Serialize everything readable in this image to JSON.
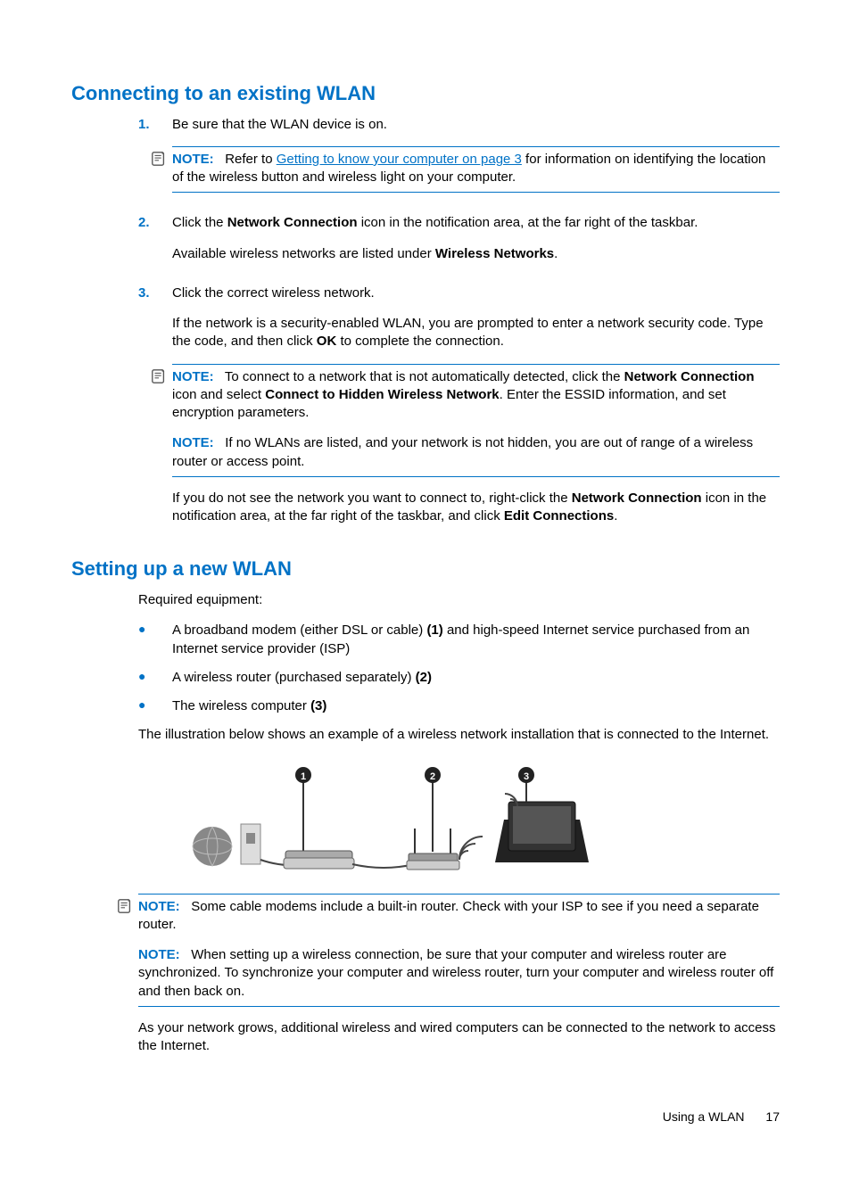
{
  "section1": {
    "title": "Connecting to an existing WLAN"
  },
  "step1": {
    "num": "1.",
    "text": "Be sure that the WLAN device is on."
  },
  "note1": {
    "label": "NOTE:",
    "pre": "Refer to ",
    "link": "Getting to know your computer on page 3",
    "post": " for information on identifying the location of the wireless button and wireless light on your computer."
  },
  "step2": {
    "num": "2.",
    "p1a": "Click the ",
    "p1b": "Network Connection",
    "p1c": " icon in the notification area, at the far right of the taskbar.",
    "p2a": "Available wireless networks are listed under ",
    "p2b": "Wireless Networks",
    "p2c": "."
  },
  "step3": {
    "num": "3.",
    "p1": "Click the correct wireless network.",
    "p2a": "If the network is a security-enabled WLAN, you are prompted to enter a network security code. Type the code, and then click ",
    "p2b": "OK",
    "p2c": " to complete the connection."
  },
  "note2": {
    "label": "NOTE:",
    "t1": "To connect to a network that is not automatically detected, click the ",
    "b1": "Network Connection",
    "t2": " icon and select ",
    "b2": "Connect to Hidden Wireless Network",
    "t3": ". Enter the ESSID information, and set encryption parameters.",
    "second_label": "NOTE:",
    "s1": "If no WLANs are listed, and your network is not hidden, you are out of range of a wireless router or access point."
  },
  "post3": {
    "a": "If you do not see the network you want to connect to, right-click the ",
    "b": "Network Connection",
    "c": " icon in the notification area, at the far right of the taskbar, and click ",
    "d": "Edit Connections",
    "e": "."
  },
  "section2": {
    "title": "Setting up a new WLAN"
  },
  "req_intro": "Required equipment:",
  "bul1": {
    "a": "A broadband modem (either DSL or cable) ",
    "b": "(1)",
    "c": " and high-speed Internet service purchased from an Internet service provider (ISP)"
  },
  "bul2": {
    "a": "A wireless router (purchased separately) ",
    "b": "(2)"
  },
  "bul3": {
    "a": "The wireless computer ",
    "b": "(3)"
  },
  "illus_intro": "The illustration below shows an example of a wireless network installation that is connected to the Internet.",
  "labels": {
    "l1": "1",
    "l2": "2",
    "l3": "3"
  },
  "note3": {
    "label": "NOTE:",
    "text": "Some cable modems include a built-in router. Check with your ISP to see if you need a separate router."
  },
  "note4": {
    "label": "NOTE:",
    "text": "When setting up a wireless connection, be sure that your computer and wireless router are synchronized. To synchronize your computer and wireless router, turn your computer and wireless router off and then back on."
  },
  "closing": "As your network grows, additional wireless and wired computers can be connected to the network to access the Internet.",
  "footer": {
    "section": "Using a WLAN",
    "page": "17"
  }
}
